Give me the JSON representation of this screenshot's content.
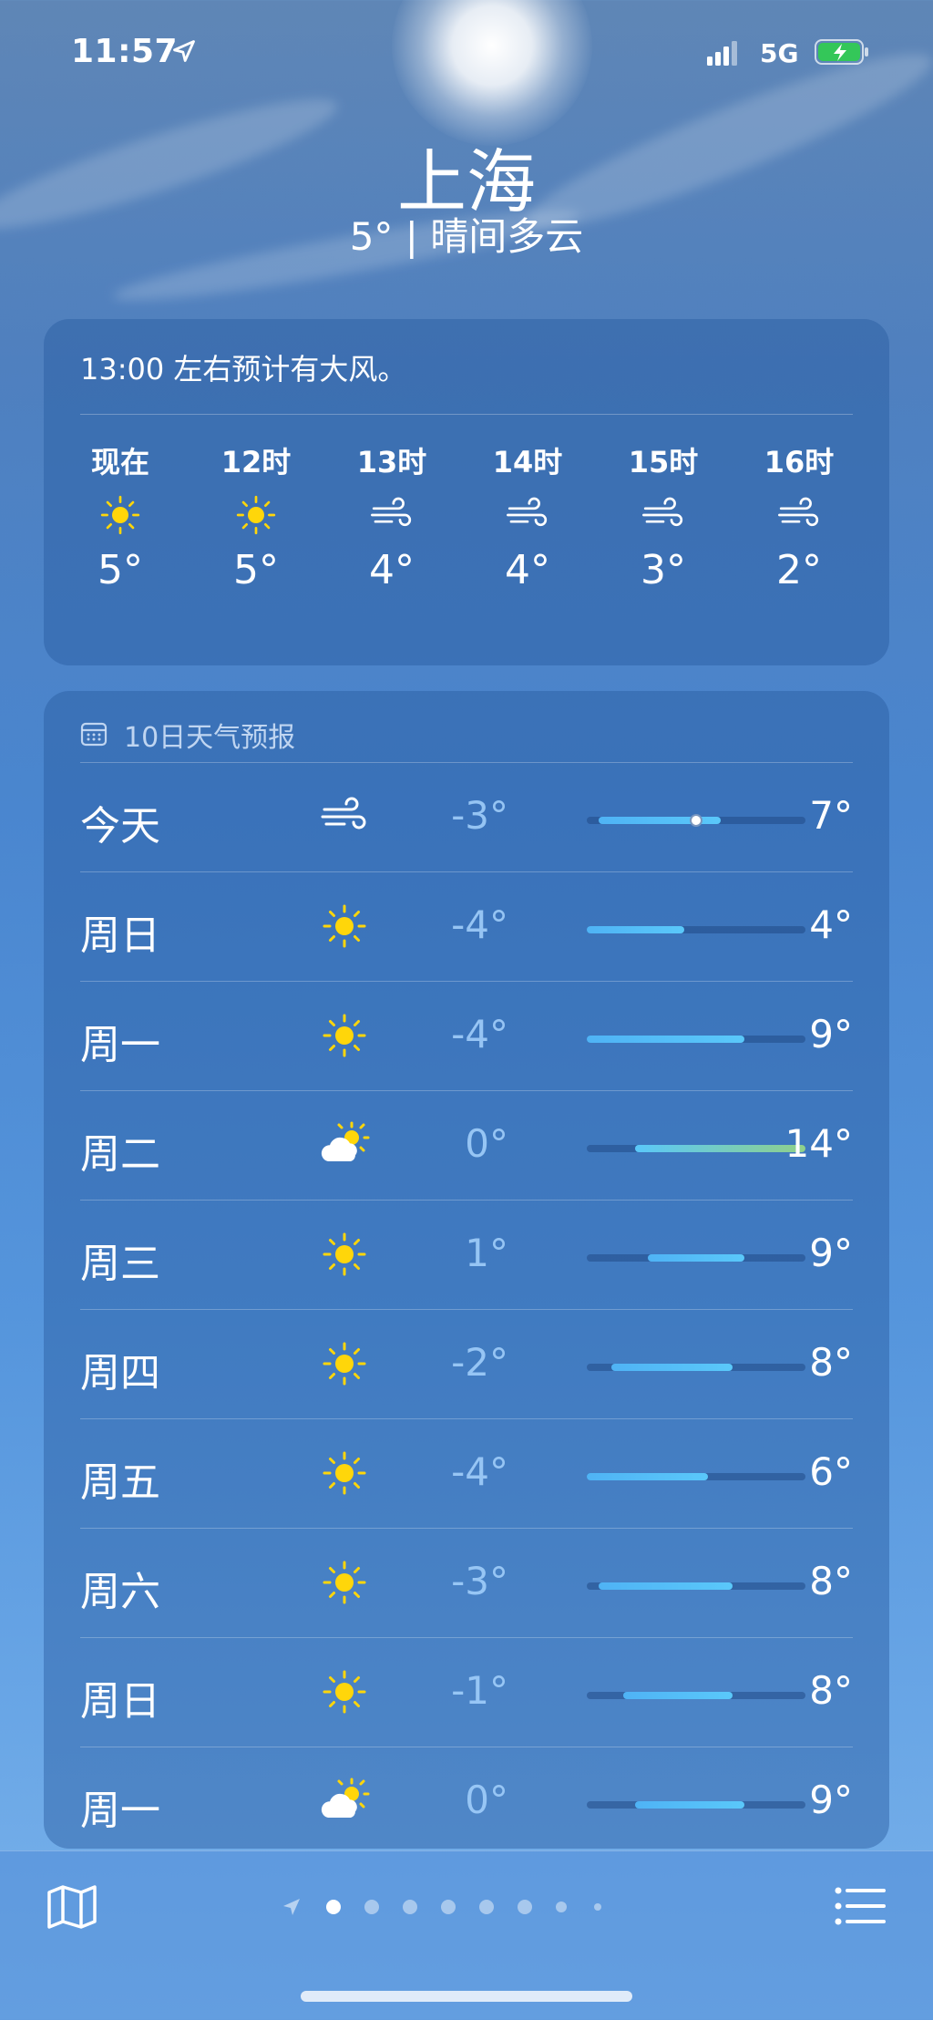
{
  "status_bar": {
    "time": "11:57",
    "network": "5G"
  },
  "location": {
    "city": "上海",
    "summary": "5° | 晴间多云"
  },
  "hourly": {
    "alert": "13:00 左右预计有大风。",
    "items": [
      {
        "label": "现在",
        "icon": "sun-icon",
        "temp": "5°"
      },
      {
        "label": "12时",
        "icon": "sun-icon",
        "temp": "5°"
      },
      {
        "label": "13时",
        "icon": "wind-icon",
        "temp": "4°"
      },
      {
        "label": "14时",
        "icon": "wind-icon",
        "temp": "4°"
      },
      {
        "label": "15时",
        "icon": "wind-icon",
        "temp": "3°"
      },
      {
        "label": "16时",
        "icon": "wind-icon",
        "temp": "2°"
      }
    ]
  },
  "daily": {
    "title": "10日天气预报",
    "range_min": -4,
    "range_max": 14,
    "days": [
      {
        "day": "今天",
        "icon": "wind-icon",
        "low": "-3°",
        "high": "7°",
        "low_v": -3,
        "high_v": 7,
        "current_v": 5
      },
      {
        "day": "周日",
        "icon": "sun-icon",
        "low": "-4°",
        "high": "4°",
        "low_v": -4,
        "high_v": 4
      },
      {
        "day": "周一",
        "icon": "sun-icon",
        "low": "-4°",
        "high": "9°",
        "low_v": -4,
        "high_v": 9
      },
      {
        "day": "周二",
        "icon": "partly-cloudy-icon",
        "low": "0°",
        "high": "14°",
        "low_v": 0,
        "high_v": 14
      },
      {
        "day": "周三",
        "icon": "sun-icon",
        "low": "1°",
        "high": "9°",
        "low_v": 1,
        "high_v": 9
      },
      {
        "day": "周四",
        "icon": "sun-icon",
        "low": "-2°",
        "high": "8°",
        "low_v": -2,
        "high_v": 8
      },
      {
        "day": "周五",
        "icon": "sun-icon",
        "low": "-4°",
        "high": "6°",
        "low_v": -4,
        "high_v": 6
      },
      {
        "day": "周六",
        "icon": "sun-icon",
        "low": "-3°",
        "high": "8°",
        "low_v": -3,
        "high_v": 8
      },
      {
        "day": "周日",
        "icon": "sun-icon",
        "low": "-1°",
        "high": "8°",
        "low_v": -1,
        "high_v": 8
      },
      {
        "day": "周一",
        "icon": "partly-cloudy-icon",
        "low": "0°",
        "high": "9°",
        "low_v": 0,
        "high_v": 9
      }
    ]
  },
  "bottom_bar": {
    "page_count": 9,
    "active_page": 0
  },
  "colors": {
    "sun": "#ffd60a",
    "bar_cool": "#5ac8fa",
    "bar_warm": "#8fd08a",
    "text_low": "#a0cdfa"
  }
}
